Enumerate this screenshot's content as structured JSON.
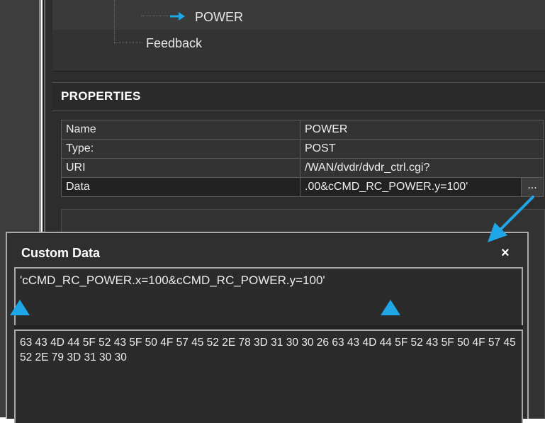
{
  "tree": {
    "power_node": "POWER",
    "feedback_node": "Feedback"
  },
  "properties": {
    "title": "PROPERTIES",
    "rows": [
      {
        "name": "Name",
        "value": "POWER"
      },
      {
        "name": "Type:",
        "value": "POST"
      },
      {
        "name": "URI",
        "value": "/WAN/dvdr/dvdr_ctrl.cgi?"
      },
      {
        "name": "Data",
        "value": ".00&cCMD_RC_POWER.y=100'"
      }
    ],
    "ellipsis_label": "..."
  },
  "dialog": {
    "title": "Custom Data",
    "close_label": "×",
    "input_value": "'cCMD_RC_POWER.x=100&cCMD_RC_POWER.y=100'",
    "hex_value": "63 43 4D 44 5F 52 43 5F 50 4F 57 45 52 2E 78 3D 31 30 30 26 63 43 4D 44 5F 52 43 5F 50 4F 57 45 52 2E 79 3D 31 30 30"
  },
  "colors": {
    "annotation_blue": "#1ea6e6",
    "panel_dark": "#2d2d2d"
  },
  "icons": {
    "tree_arrow": "arrow-right-icon",
    "close": "close-icon",
    "annotation_marker": "triangle-up-icon",
    "annotation_pointer": "arrow-pointer-icon"
  }
}
